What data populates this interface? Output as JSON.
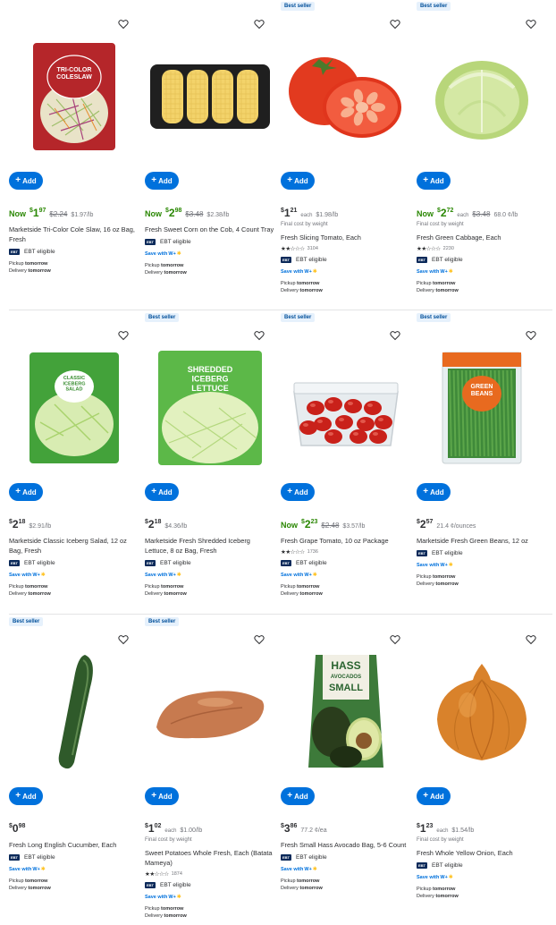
{
  "ui": {
    "add_label": "Add",
    "add_plus": "+",
    "ebt_tag": "EBT",
    "ebt_label": "EBT eligible",
    "save_with": "Save with",
    "w_plus": "W+",
    "pickup_label": "Pickup",
    "delivery_label": "Delivery",
    "tomorrow": "tomorrow",
    "best_seller": "Best seller",
    "final_cost": "Final cost by weight",
    "now_label": "Now",
    "each_label": "each"
  },
  "products": [
    {
      "badge": "",
      "now": true,
      "dollars": "1",
      "cents": "97",
      "was": "$2.24",
      "unit": "$1.97/lb",
      "each": false,
      "final_cost": false,
      "title": "Marketside Tri-Color Cole Slaw, 16 oz Bag, Fresh",
      "stars": "",
      "reviews": "",
      "ebt": true,
      "save_with": false,
      "image": "coleslaw-bag"
    },
    {
      "badge": "",
      "now": true,
      "dollars": "2",
      "cents": "98",
      "was": "$3.48",
      "unit": "$2.38/lb",
      "each": false,
      "final_cost": false,
      "title": "Fresh Sweet Corn on the Cob, 4 Count Tray",
      "stars": "",
      "reviews": "",
      "ebt": true,
      "save_with": true,
      "image": "corn-tray"
    },
    {
      "badge": "Best seller",
      "now": false,
      "dollars": "1",
      "cents": "21",
      "was": "",
      "unit": "$1.98/lb",
      "each": true,
      "final_cost": true,
      "title": "Fresh Slicing Tomato, Each",
      "stars": "★★☆☆☆",
      "reviews": "3104",
      "ebt": true,
      "save_with": true,
      "image": "tomato"
    },
    {
      "badge": "Best seller",
      "now": true,
      "dollars": "2",
      "cents": "72",
      "was": "$3.48",
      "unit": "68.0 ¢/lb",
      "each": true,
      "final_cost": true,
      "title": "Fresh Green Cabbage, Each",
      "stars": "★★☆☆☆",
      "reviews": "2230",
      "ebt": true,
      "save_with": true,
      "image": "cabbage"
    },
    {
      "badge": "",
      "now": false,
      "dollars": "2",
      "cents": "18",
      "was": "",
      "unit": "$2.91/lb",
      "each": false,
      "final_cost": false,
      "title": "Marketside Classic Iceberg Salad, 12 oz Bag, Fresh",
      "stars": "",
      "reviews": "",
      "ebt": true,
      "save_with": true,
      "image": "classic-salad"
    },
    {
      "badge": "Best seller",
      "now": false,
      "dollars": "2",
      "cents": "18",
      "was": "",
      "unit": "$4.36/lb",
      "each": false,
      "final_cost": false,
      "title": "Marketside Fresh Shredded Iceberg Lettuce, 8 oz Bag, Fresh",
      "stars": "",
      "reviews": "",
      "ebt": true,
      "save_with": true,
      "image": "shredded-lettuce"
    },
    {
      "badge": "Best seller",
      "now": true,
      "dollars": "2",
      "cents": "23",
      "was": "$2.48",
      "unit": "$3.57/lb",
      "each": false,
      "final_cost": false,
      "title": "Fresh Grape Tomato, 10 oz Package",
      "stars": "★★☆☆☆",
      "reviews": "1736",
      "ebt": true,
      "save_with": true,
      "image": "grape-tomato"
    },
    {
      "badge": "Best seller",
      "now": false,
      "dollars": "2",
      "cents": "57",
      "was": "",
      "unit": "21.4 ¢/ounces",
      "each": false,
      "final_cost": false,
      "title": "Marketside Fresh Green Beans, 12 oz",
      "stars": "",
      "reviews": "",
      "ebt": true,
      "save_with": true,
      "image": "green-beans"
    },
    {
      "badge": "Best seller",
      "now": false,
      "dollars": "0",
      "cents": "98",
      "was": "",
      "unit": "",
      "each": false,
      "final_cost": false,
      "title": "Fresh Long English Cucumber, Each",
      "stars": "",
      "reviews": "",
      "ebt": true,
      "save_with": true,
      "image": "cucumber"
    },
    {
      "badge": "Best seller",
      "now": false,
      "dollars": "1",
      "cents": "02",
      "was": "",
      "unit": "$1.00/lb",
      "each": true,
      "final_cost": true,
      "title": "Sweet Potatoes Whole Fresh, Each (Batata Mameya)",
      "stars": "★★☆☆☆",
      "reviews": "1874",
      "ebt": true,
      "save_with": true,
      "image": "sweet-potato"
    },
    {
      "badge": "",
      "now": false,
      "dollars": "3",
      "cents": "86",
      "was": "",
      "unit": "77.2 ¢/ea",
      "each": false,
      "final_cost": false,
      "title": "Fresh Small Hass Avocado Bag, 5-6 Count",
      "stars": "",
      "reviews": "",
      "ebt": true,
      "save_with": true,
      "image": "avocado-bag"
    },
    {
      "badge": "",
      "now": false,
      "dollars": "1",
      "cents": "23",
      "was": "",
      "unit": "$1.54/lb",
      "each": true,
      "final_cost": true,
      "title": "Fresh Whole Yellow Onion, Each",
      "stars": "",
      "reviews": "",
      "ebt": true,
      "save_with": true,
      "image": "onion"
    }
  ],
  "image_text": {
    "coleslaw": "TRI-COLOR COLESLAW",
    "classic": "CLASSIC ICEBERG SALAD",
    "shredded": "SHREDDED ICEBERG LETTUCE",
    "beans": "GREEN BEANS",
    "avocado_1": "HASS",
    "avocado_2": "AVOCADOS",
    "avocado_3": "SMALL"
  }
}
